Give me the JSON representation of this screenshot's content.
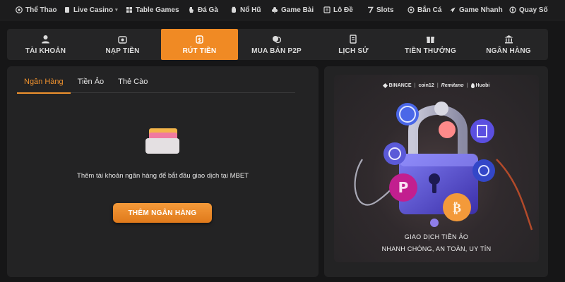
{
  "topnav": {
    "items": [
      {
        "label": "Thể Thao",
        "icon": "soccer-ball-icon"
      },
      {
        "label": "Live Casino",
        "icon": "cards-icon",
        "caret": true
      },
      {
        "label": "Table Games",
        "icon": "grid-icon"
      },
      {
        "label": "Đá Gà",
        "icon": "rooster-icon"
      },
      {
        "label": "Nổ Hũ",
        "icon": "jar-icon"
      },
      {
        "label": "Game Bài",
        "icon": "club-icon"
      },
      {
        "label": "Lô Đề",
        "icon": "lottery-icon"
      },
      {
        "label": "Slots",
        "icon": "seven-icon"
      },
      {
        "label": "Bắn Cá",
        "icon": "target-icon"
      },
      {
        "label": "Game Nhanh",
        "icon": "rocket-icon"
      },
      {
        "label": "Quay Số",
        "icon": "spin-icon"
      }
    ]
  },
  "tabs": [
    {
      "label": "TÀI KHOẢN",
      "icon": "user-icon",
      "active": false
    },
    {
      "label": "NẠP TIỀN",
      "icon": "deposit-icon",
      "active": false
    },
    {
      "label": "RÚT TIỀN",
      "icon": "withdraw-icon",
      "active": true
    },
    {
      "label": "MUA BÁN P2P",
      "icon": "coins-icon",
      "active": false
    },
    {
      "label": "LỊCH SỬ",
      "icon": "history-icon",
      "active": false
    },
    {
      "label": "TIỀN THƯỞNG",
      "icon": "bonus-icon",
      "active": false
    },
    {
      "label": "NGÂN HÀNG",
      "icon": "bank-icon",
      "active": false
    }
  ],
  "withdraw": {
    "subtabs": [
      {
        "label": "Ngân Hàng",
        "active": true
      },
      {
        "label": "Tiền Ảo",
        "active": false
      },
      {
        "label": "Thẻ Cào",
        "active": false
      }
    ],
    "empty_message": "Thêm tài khoản ngân hàng để bắt đầu giao dịch tại MBET",
    "add_button": "THÊM NGÂN HÀNG"
  },
  "promo": {
    "partners": [
      "BINANCE",
      "coin12",
      "Remitano",
      "Huobi"
    ],
    "title": "GIAO DỊCH TIỀN ẢO",
    "subtitle": "NHANH CHÓNG, AN TOÀN, UY TÍN"
  },
  "colors": {
    "accent": "#f08a24",
    "background": "#161617",
    "panel": "#232324"
  }
}
